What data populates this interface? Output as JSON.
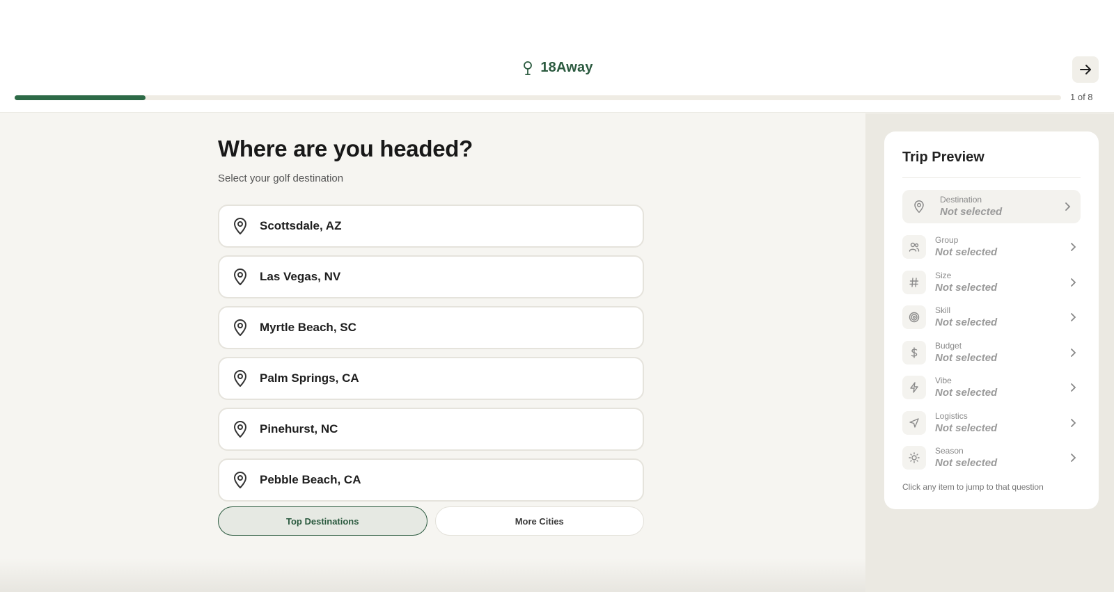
{
  "header": {
    "brand": "18Away",
    "step_text": "1 of 8",
    "progress": 0.125,
    "next_icon": "arrow-right-icon",
    "brand_icon": "golf-tee-icon",
    "accent_color": "#2d6a47"
  },
  "main": {
    "title": "Where are you headed?",
    "subtitle": "Select your golf destination",
    "options": [
      {
        "label": "Scottsdale, AZ",
        "icon": "map-pin-icon"
      },
      {
        "label": "Las Vegas, NV",
        "icon": "map-pin-icon"
      },
      {
        "label": "Myrtle Beach, SC",
        "icon": "map-pin-icon"
      },
      {
        "label": "Palm Springs, CA",
        "icon": "map-pin-icon"
      },
      {
        "label": "Pinehurst, NC",
        "icon": "map-pin-icon"
      },
      {
        "label": "Pebble Beach, CA",
        "icon": "map-pin-icon"
      }
    ],
    "tabs": [
      {
        "label": "Top Destinations",
        "active": true
      },
      {
        "label": "More Cities",
        "active": false
      }
    ]
  },
  "sidebar": {
    "title": "Trip Preview",
    "items": [
      {
        "label": "Destination",
        "value": "Not selected",
        "icon": "map-pin-icon"
      },
      {
        "label": "Group",
        "value": "Not selected",
        "icon": "users-icon"
      },
      {
        "label": "Size",
        "value": "Not selected",
        "icon": "hash-icon"
      },
      {
        "label": "Skill",
        "value": "Not selected",
        "icon": "target-icon"
      },
      {
        "label": "Budget",
        "value": "Not selected",
        "icon": "dollar-icon"
      },
      {
        "label": "Vibe",
        "value": "Not selected",
        "icon": "lightning-icon"
      },
      {
        "label": "Logistics",
        "value": "Not selected",
        "icon": "navigation-icon"
      },
      {
        "label": "Season",
        "value": "Not selected",
        "icon": "sun-icon"
      }
    ],
    "hint": "Click any item to jump to that question"
  }
}
